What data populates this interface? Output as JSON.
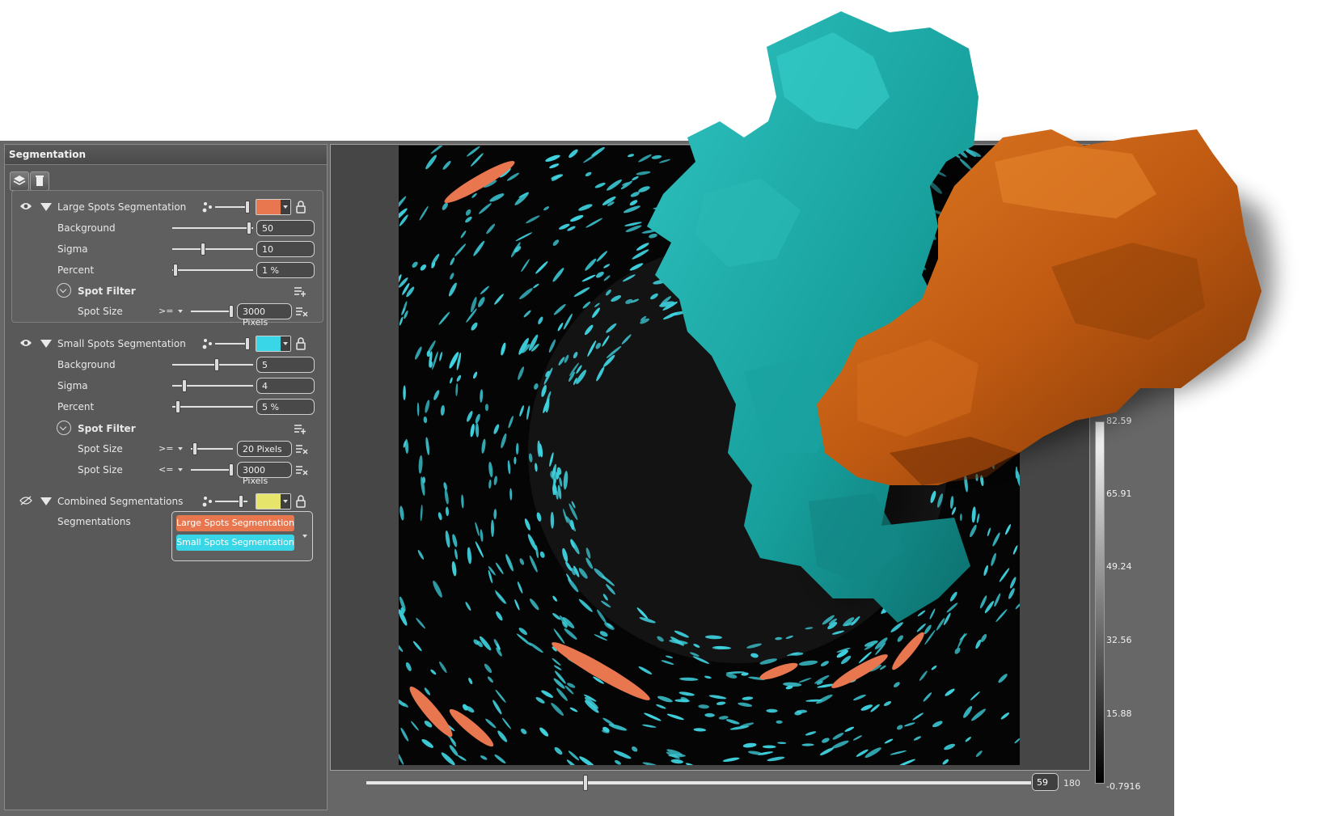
{
  "panel": {
    "title": "Segmentation"
  },
  "segmentations": [
    {
      "name": "Large Spots Segmentation",
      "color": "#e8764f",
      "visible": true,
      "params": [
        {
          "label": "Background",
          "value": "50",
          "level": 0.95
        },
        {
          "label": "Sigma",
          "value": "10",
          "level": 0.38
        },
        {
          "label": "Percent",
          "value": "1 %",
          "level": 0.04
        }
      ],
      "spot_filter": {
        "label": "Spot Filter",
        "rules": [
          {
            "label": "Spot Size",
            "op": ">=",
            "value": "3000 Pixels",
            "level": 0.97
          }
        ]
      }
    },
    {
      "name": "Small Spots Segmentation",
      "color": "#38d6e6",
      "visible": true,
      "params": [
        {
          "label": "Background",
          "value": "5",
          "level": 0.55
        },
        {
          "label": "Sigma",
          "value": "4",
          "level": 0.15
        },
        {
          "label": "Percent",
          "value": "5 %",
          "level": 0.07
        }
      ],
      "spot_filter": {
        "label": "Spot Filter",
        "rules": [
          {
            "label": "Spot Size",
            "op": ">=",
            "value": "20 Pixels",
            "level": 0.1
          },
          {
            "label": "Spot Size",
            "op": "<=",
            "value": "3000 Pixels",
            "level": 0.97
          }
        ]
      }
    },
    {
      "name": "Combined Segmentations",
      "color": "#e6e46a",
      "visible": false,
      "list_label": "Segmentations",
      "members": [
        "Large Spots Segmentation",
        "Small Spots Segmentation"
      ]
    }
  ],
  "viewer": {
    "frame": "59",
    "frame_max": "180",
    "frame_level": 0.33,
    "colorbar": [
      "82.59",
      "65.91",
      "49.24",
      "32.56",
      "15.88",
      "-0.7916"
    ]
  },
  "colors": {
    "teal": "#1fa8a5",
    "orange": "#c85f14",
    "spot_cyan": "#3fd3e0",
    "spot_orange": "#e8774f"
  },
  "icons": [
    "eye-icon",
    "eye-hidden-icon",
    "collapse-triangle-icon",
    "spots-icon",
    "lock-icon",
    "chevron-down-icon",
    "add-filter-icon",
    "clear-filter-icon",
    "layers-icon",
    "delete-icon"
  ]
}
